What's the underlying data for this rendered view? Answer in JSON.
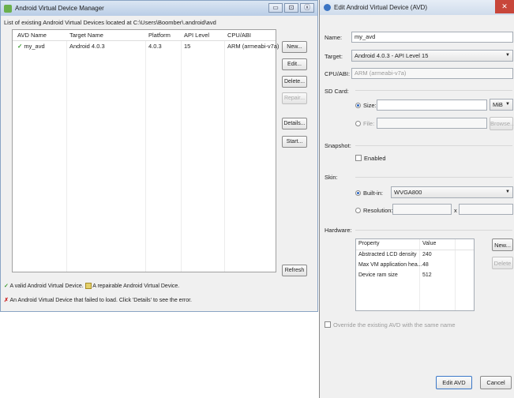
{
  "manager": {
    "title": "Android Virtual Device Manager",
    "window_buttons": [
      "▭",
      "⊡",
      "ⓧ"
    ],
    "path_text": "List of existing Android Virtual Devices located at C:\\Users\\Boomber\\.android\\avd",
    "columns": [
      "AVD Name",
      "Target Name",
      "Platform",
      "API Level",
      "CPU/ABI"
    ],
    "rows": [
      {
        "status_icon": "check-icon",
        "name": "my_avd",
        "target": "Android 4.0.3",
        "platform": "4.0.3",
        "api": "15",
        "cpu": "ARM (armeabi-v7a)"
      }
    ],
    "buttons": {
      "new": "New...",
      "edit": "Edit...",
      "delete": "Delete...",
      "repair": "Repair...",
      "details": "Details...",
      "start": "Start...",
      "refresh": "Refresh"
    },
    "legend": {
      "valid": "A valid Android Virtual Device.",
      "repairable": "A repairable Android Virtual Device.",
      "failed": "An Android Virtual Device that failed to load. Click 'Details' to see the error."
    }
  },
  "edit": {
    "title": "Edit Android Virtual Device (AVD)",
    "close": "✕",
    "name_label": "Name:",
    "name_value": "my_avd",
    "target_label": "Target:",
    "target_value": "Android 4.0.3 - API Level 15",
    "cpu_label": "CPU/ABI:",
    "cpu_value": "ARM (armeabi-v7a)",
    "sd_label": "SD Card:",
    "sd_size_label": "Size:",
    "sd_size_value": "",
    "sd_unit": "MiB",
    "sd_file_label": "File:",
    "browse": "Browse...",
    "snapshot_label": "Snapshot:",
    "snapshot_enabled": "Enabled",
    "skin_label": "Skin:",
    "builtin_label": "Built-in:",
    "builtin_value": "WVGA800",
    "resolution_label": "Resolution:",
    "res_x": "x",
    "hardware_label": "Hardware:",
    "hw_columns": [
      "Property",
      "Value"
    ],
    "hw_rows": [
      {
        "property": "Abstracted LCD density",
        "value": "240"
      },
      {
        "property": "Max VM application hea...",
        "value": "48"
      },
      {
        "property": "Device ram size",
        "value": "512"
      }
    ],
    "hw_new": "New...",
    "hw_delete": "Delete",
    "override": "Override the existing AVD with the same name",
    "edit_button": "Edit AVD",
    "cancel_button": "Cancel"
  },
  "colors": {
    "valid": "#3a9a2e",
    "failed": "#cc2222",
    "title_bar": "#c9d9ee",
    "close": "#c8463a"
  }
}
